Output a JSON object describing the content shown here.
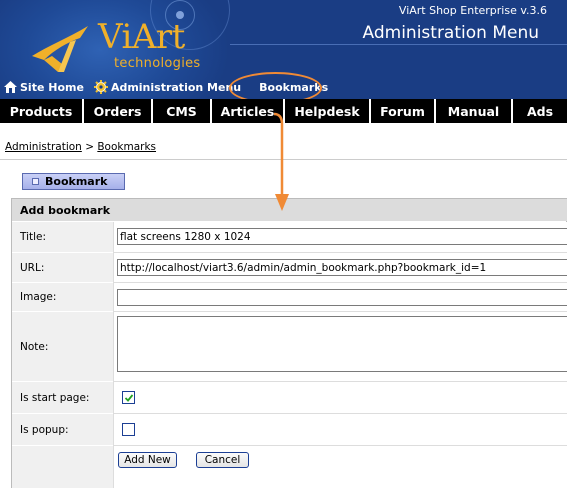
{
  "header": {
    "logo_text": "ViArt",
    "logo_sub": "technologies",
    "version": "ViArt Shop Enterprise v.3.6",
    "title": "Administration Menu",
    "links": [
      {
        "label": "Site Home",
        "icon": "house-icon"
      },
      {
        "label": "Administration Menu",
        "icon": "gear-icon"
      },
      {
        "label": "Bookmarks",
        "icon": null
      }
    ],
    "highlight_color": "#f08a35"
  },
  "nav": [
    {
      "label": "Products"
    },
    {
      "label": "Orders"
    },
    {
      "label": "CMS"
    },
    {
      "label": "Articles"
    },
    {
      "label": "Helpdesk"
    },
    {
      "label": "Forum"
    },
    {
      "label": "Manual"
    },
    {
      "label": "Ads"
    }
  ],
  "breadcrumb": {
    "items": [
      "Administration",
      "Bookmarks"
    ],
    "separator": ">"
  },
  "tab": {
    "label": "Bookmark"
  },
  "form": {
    "title": "Add bookmark",
    "fields": {
      "title": {
        "label": "Title:",
        "value": "flat screens 1280 x 1024"
      },
      "url": {
        "label": "URL:",
        "value": "http://localhost/viart3.6/admin/admin_bookmark.php?bookmark_id=1"
      },
      "image": {
        "label": "Image:",
        "value": ""
      },
      "note": {
        "label": "Note:",
        "value": ""
      },
      "start_page": {
        "label": "Is start page:",
        "checked": true
      },
      "popup": {
        "label": "Is popup:",
        "checked": false
      }
    },
    "buttons": {
      "add": "Add New",
      "cancel": "Cancel"
    }
  },
  "colors": {
    "header_bg": "#1a3d84",
    "logo": "#f0b02a",
    "nav_bg": "#000000",
    "accent_orange": "#f08a35"
  }
}
